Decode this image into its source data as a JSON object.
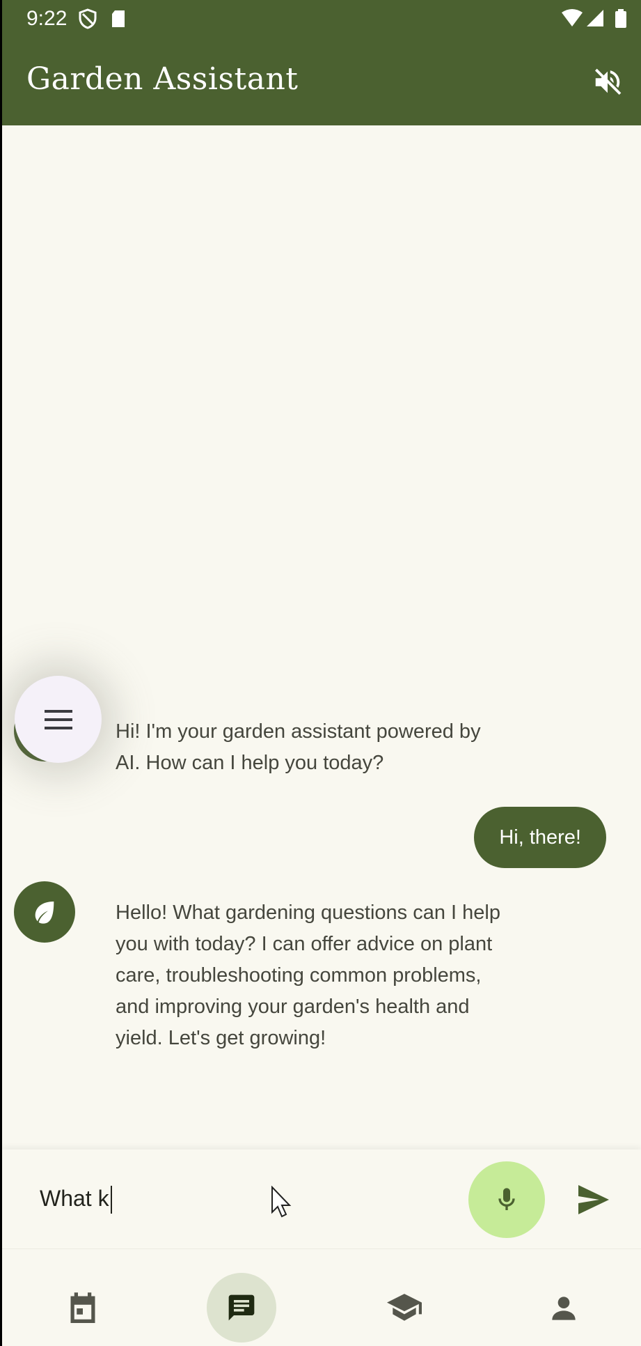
{
  "status_bar": {
    "time": "9:22",
    "icons": [
      "shield-icon",
      "sd-card-icon",
      "wifi-icon",
      "signal-icon",
      "battery-icon"
    ]
  },
  "app_bar": {
    "title": "Garden  Assistant",
    "mute_icon": "volume-off-icon"
  },
  "chat": {
    "messages": [
      {
        "role": "assistant",
        "text": "Hi! I'm your garden assistant powered by AI. How can I help you today?"
      },
      {
        "role": "user",
        "text": "Hi, there!"
      },
      {
        "role": "assistant",
        "text": "Hello!  What gardening questions can I help you with today?  I can offer advice on plant care, troubleshooting common problems, and improving your garden's health and yield.  Let's get growing!"
      }
    ]
  },
  "input": {
    "value": "What k"
  },
  "bottom_nav": {
    "items": [
      {
        "icon": "calendar-icon",
        "selected": false
      },
      {
        "icon": "chat-icon",
        "selected": true
      },
      {
        "icon": "school-icon",
        "selected": false
      },
      {
        "icon": "person-icon",
        "selected": false
      }
    ]
  },
  "colors": {
    "primary": "#4b6130",
    "background": "#f9f8f0",
    "mic_background": "#c6eb98",
    "nav_selected": "#dde3cf"
  }
}
